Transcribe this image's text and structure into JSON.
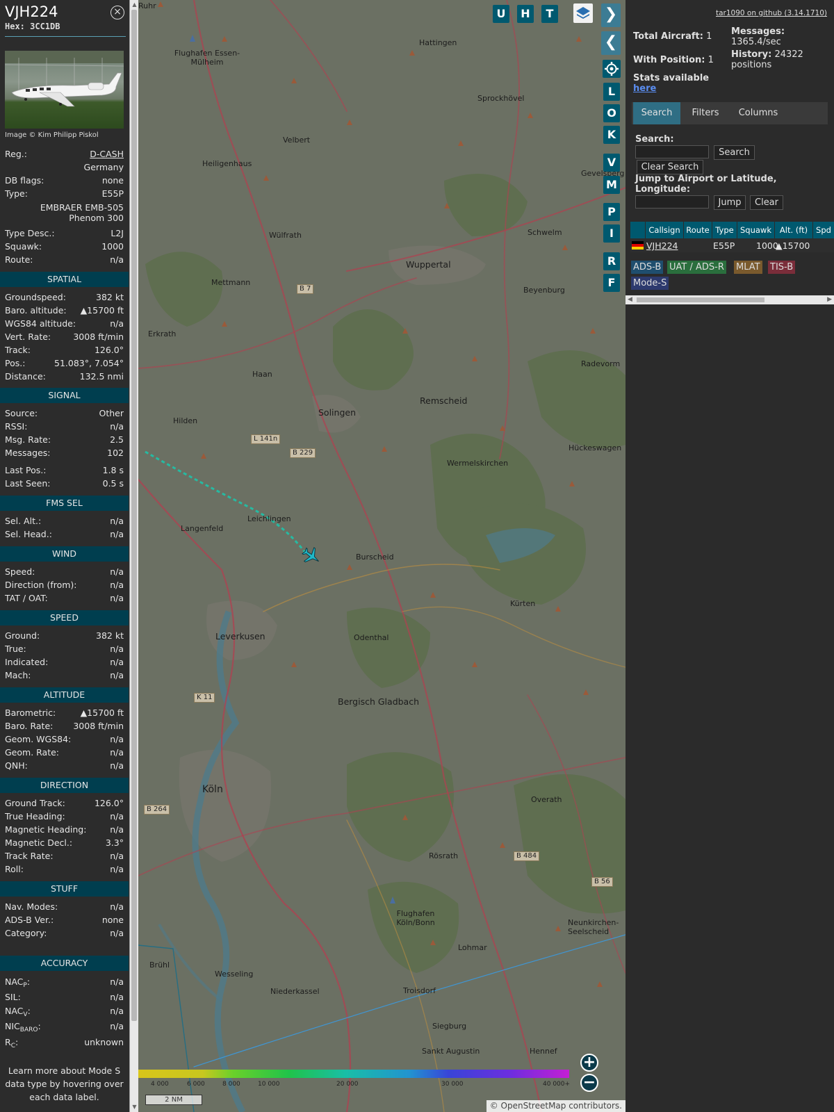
{
  "sidebar": {
    "callsign": "VJH224",
    "hex": "Hex: 3CC1DB",
    "close_symbol": "×",
    "photo_caption": "Image © Kim Philipp Piskol",
    "header_rows": [
      {
        "label": "Reg.:",
        "value": "D-CASH",
        "link": true
      },
      {
        "label": "",
        "value": "Germany"
      },
      {
        "label": "DB flags:",
        "value": "none"
      },
      {
        "label": "Type:",
        "value": "E55P"
      },
      {
        "label": "",
        "value": "EMBRAER EMB-505"
      },
      {
        "label": "",
        "value": "Phenom 300"
      },
      {
        "label": "Type Desc.:",
        "value": "L2J"
      },
      {
        "label": "Squawk:",
        "value": "1000"
      },
      {
        "label": "Route:",
        "value": "n/a"
      }
    ],
    "sections": {
      "spatial": "SPATIAL",
      "signal": "SIGNAL",
      "fms": "FMS SEL",
      "wind": "WIND",
      "speed": "SPEED",
      "altitude": "ALTITUDE",
      "direction": "DIRECTION",
      "stuff": "STUFF",
      "accuracy": "ACCURACY"
    },
    "spatial_rows": [
      {
        "label": "Groundspeed:",
        "value": "382 kt"
      },
      {
        "label": "Baro. altitude:",
        "value": "▲15700 ft"
      },
      {
        "label": "WGS84 altitude:",
        "value": "n/a"
      },
      {
        "label": "Vert. Rate:",
        "value": "3008 ft/min"
      },
      {
        "label": "Track:",
        "value": "126.0°"
      },
      {
        "label": "Pos.:",
        "value": "51.083°, 7.054°"
      },
      {
        "label": "Distance:",
        "value": "132.5 nmi"
      }
    ],
    "signal_rows": [
      {
        "label": "Source:",
        "value": "Other"
      },
      {
        "label": "RSSI:",
        "value": "n/a"
      },
      {
        "label": "Msg. Rate:",
        "value": "2.5"
      },
      {
        "label": "Messages:",
        "value": "102"
      },
      {
        "label": "Last Pos.:",
        "value": "1.8 s"
      },
      {
        "label": "Last Seen:",
        "value": "0.5 s"
      }
    ],
    "fms_rows": [
      {
        "label": "Sel. Alt.:",
        "value": "n/a"
      },
      {
        "label": "Sel. Head.:",
        "value": "n/a"
      }
    ],
    "wind_rows": [
      {
        "label": "Speed:",
        "value": "n/a"
      },
      {
        "label": "Direction (from):",
        "value": "n/a"
      },
      {
        "label": "TAT / OAT:",
        "value": "n/a"
      }
    ],
    "speed_rows": [
      {
        "label": "Ground:",
        "value": "382 kt"
      },
      {
        "label": "True:",
        "value": "n/a"
      },
      {
        "label": "Indicated:",
        "value": "n/a"
      },
      {
        "label": "Mach:",
        "value": "n/a"
      }
    ],
    "altitude_rows": [
      {
        "label": "Barometric:",
        "value": "▲15700 ft"
      },
      {
        "label": "Baro. Rate:",
        "value": "3008 ft/min"
      },
      {
        "label": "Geom. WGS84:",
        "value": "n/a"
      },
      {
        "label": "Geom. Rate:",
        "value": "n/a"
      },
      {
        "label": "QNH:",
        "value": "n/a"
      }
    ],
    "direction_rows": [
      {
        "label": "Ground Track:",
        "value": "126.0°"
      },
      {
        "label": "True Heading:",
        "value": "n/a"
      },
      {
        "label": "Magnetic Heading:",
        "value": "n/a"
      },
      {
        "label": "Magnetic Decl.:",
        "value": "3.3°"
      },
      {
        "label": "Track Rate:",
        "value": "n/a"
      },
      {
        "label": "Roll:",
        "value": "n/a"
      }
    ],
    "stuff_rows": [
      {
        "label": "Nav. Modes:",
        "value": "n/a"
      },
      {
        "label": "ADS-B Ver.:",
        "value": "none"
      },
      {
        "label": "Category:",
        "value": "n/a"
      }
    ],
    "accuracy": {
      "nacp_main": "NAC",
      "nacp_sub": "P",
      "nacp_value": "n/a",
      "sil_label": "SIL:",
      "sil_value": "n/a",
      "nacv_main": "NAC",
      "nacv_sub": "V",
      "nacv_value": "n/a",
      "nicbaro_main": "NIC",
      "nicbaro_sub": "BARO",
      "nicbaro_value": "n/a",
      "rc_main": "R",
      "rc_sub": "C",
      "rc_value": "unknown"
    },
    "info_text": "Learn more about Mode S data type by hovering over each data label."
  },
  "map": {
    "top_buttons": [
      "U",
      "H",
      "T"
    ],
    "side_buttons": [
      "L",
      "O",
      "K",
      "V",
      "M",
      "P",
      "I",
      "R",
      "F"
    ],
    "zoom_in": "+",
    "zoom_out": "−",
    "scale_label": "2 NM",
    "attribution": "© OpenStreetMap contributors.",
    "altitude_ticks": [
      "4 000",
      "6 000",
      "8 000",
      "10 000",
      "20 000",
      "30 000",
      "40 000+"
    ],
    "cities": [
      {
        "name": "Ruhr",
        "cls": "small"
      },
      {
        "name": "Flughafen Essen-Mülheim",
        "cls": "small"
      },
      {
        "name": "Hattingen",
        "cls": "small"
      },
      {
        "name": "Sprockhövel",
        "cls": "small"
      },
      {
        "name": "Velbert",
        "cls": "small"
      },
      {
        "name": "Heiligenhaus",
        "cls": "small"
      },
      {
        "name": "Gevelsberg",
        "cls": "small"
      },
      {
        "name": "Wülfrath",
        "cls": "small"
      },
      {
        "name": "Schwelm",
        "cls": "small"
      },
      {
        "name": "Wuppertal",
        "cls": ""
      },
      {
        "name": "Mettmann",
        "cls": "small"
      },
      {
        "name": "Beyenburg",
        "cls": "small"
      },
      {
        "name": "Erkrath",
        "cls": "small"
      },
      {
        "name": "Radevorm",
        "cls": "small"
      },
      {
        "name": "Haan",
        "cls": "small"
      },
      {
        "name": "Solingen",
        "cls": ""
      },
      {
        "name": "Remscheid",
        "cls": ""
      },
      {
        "name": "Hilden",
        "cls": "small"
      },
      {
        "name": "Hückeswagen",
        "cls": "small"
      },
      {
        "name": "Wermelskirchen",
        "cls": "small"
      },
      {
        "name": "Leichlingen",
        "cls": "small"
      },
      {
        "name": "Langenfeld",
        "cls": "small"
      },
      {
        "name": "Burscheid",
        "cls": "small"
      },
      {
        "name": "Kürten",
        "cls": "small"
      },
      {
        "name": "Leverkusen",
        "cls": ""
      },
      {
        "name": "Odenthal",
        "cls": "small"
      },
      {
        "name": "Bergisch Gladbach",
        "cls": ""
      },
      {
        "name": "Overath",
        "cls": "small"
      },
      {
        "name": "Köln",
        "cls": "big"
      },
      {
        "name": "Rösrath",
        "cls": "small"
      },
      {
        "name": "Flughafen Köln/Bonn",
        "cls": "small"
      },
      {
        "name": "Neunkirchen-Seelscheid",
        "cls": "small"
      },
      {
        "name": "Lohmar",
        "cls": "small"
      },
      {
        "name": "Brühl",
        "cls": "small"
      },
      {
        "name": "Wesseling",
        "cls": "small"
      },
      {
        "name": "Niederkassel",
        "cls": "small"
      },
      {
        "name": "Troisdorf",
        "cls": "small"
      },
      {
        "name": "Siegburg",
        "cls": "small"
      },
      {
        "name": "Sankt Augustin",
        "cls": "small"
      },
      {
        "name": "Hennef",
        "cls": "small"
      }
    ],
    "road_labels": [
      "B 7",
      "L 141n",
      "B 229",
      "K 11",
      "B 264",
      "B 484",
      "B 56"
    ]
  },
  "right": {
    "tar_link": "tar1090 on github (3.14.1710)",
    "total_aircraft_label": "Total Aircraft:",
    "total_aircraft_value": "1",
    "with_position_label": "With Position:",
    "with_position_value": "1",
    "stats_text": "Stats available",
    "stats_link": "here",
    "messages_label": "Messages:",
    "messages_value": "1365.4/sec",
    "history_label": "History:",
    "history_value": "24322 positions",
    "tabs": [
      "Search",
      "Filters",
      "Columns"
    ],
    "search_label": "Search:",
    "search_button": "Search",
    "clear_search_button": "Clear Search",
    "jump_label": "Jump to Airport or Latitude, Longitude:",
    "jump_button": "Jump",
    "clear_button": "Clear",
    "columns": [
      "",
      "Callsign",
      "Route",
      "Type",
      "Squawk",
      "Alt. (ft)",
      "Spd"
    ],
    "row": {
      "callsign": "VJH224",
      "route": "",
      "type": "E55P",
      "squawk": "1000",
      "alt": "▲15700",
      "spd": ""
    },
    "sources": [
      {
        "label": "ADS-B",
        "color": "#1f4e6e"
      },
      {
        "label": "UAT / ADS-R",
        "color": "#2a6e3d"
      },
      {
        "label": "MLAT",
        "color": "#7a5a2d"
      },
      {
        "label": "TIS-B",
        "color": "#7a2d3a"
      },
      {
        "label": "Mode-S",
        "color": "#2d3a6e"
      }
    ]
  }
}
